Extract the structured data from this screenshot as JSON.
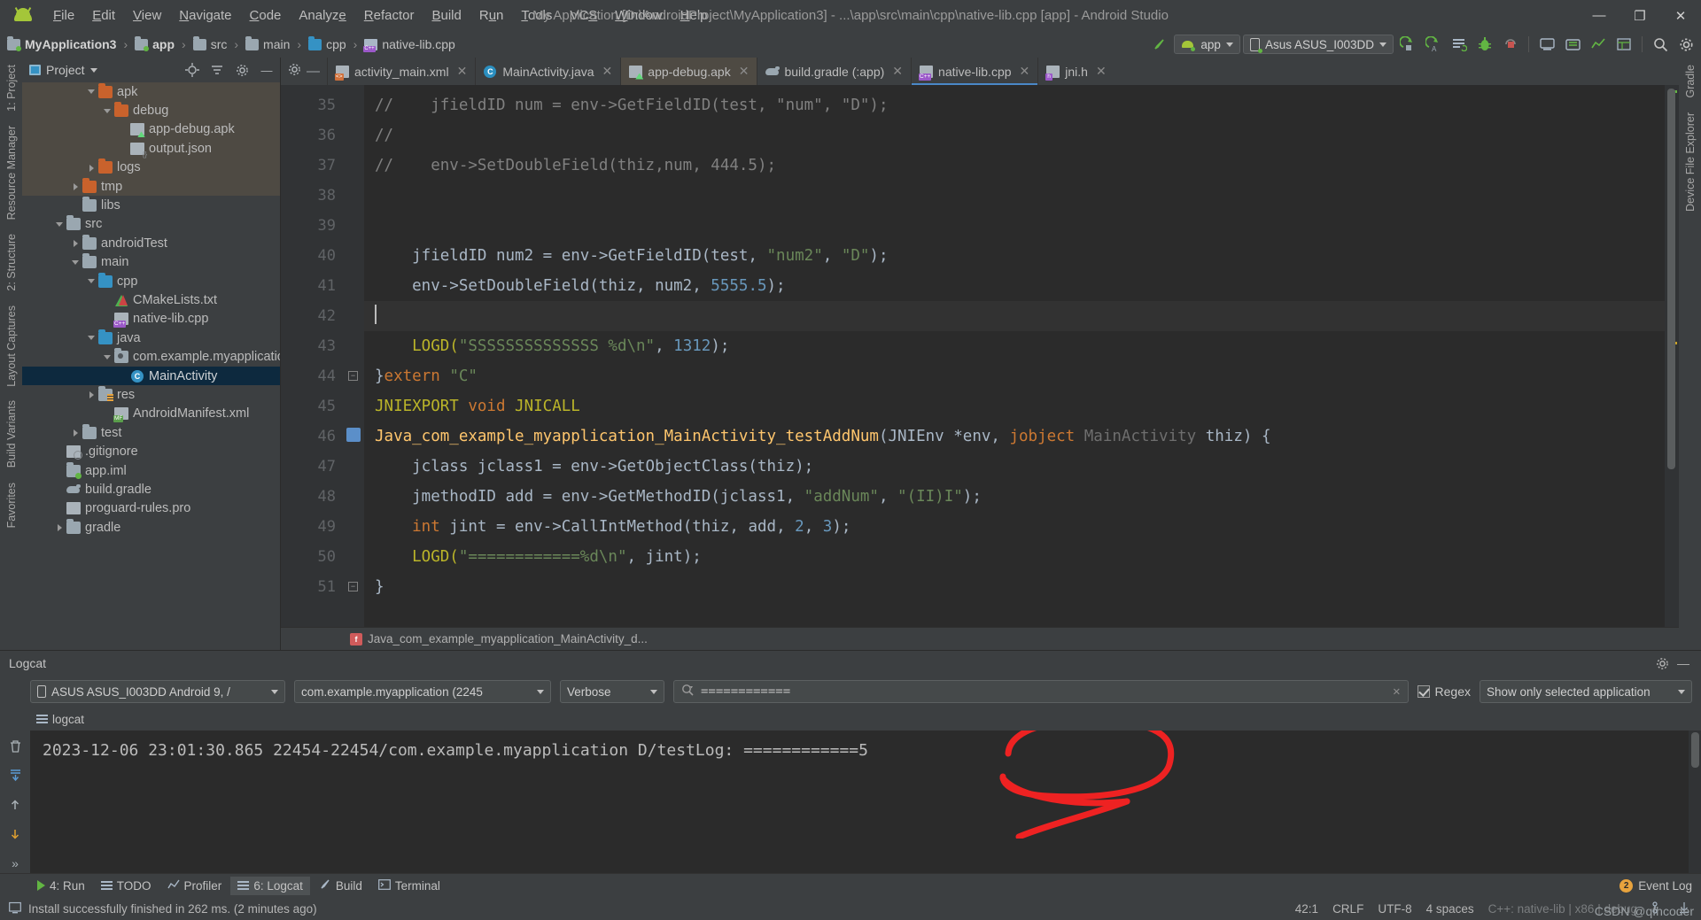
{
  "window": {
    "title": "My Application [D:\\AndroidProject\\MyApplication3] - ...\\app\\src\\main\\cpp\\native-lib.cpp [app] - Android Studio",
    "minimize": "—",
    "maximize": "❐",
    "close": "✕"
  },
  "menu": {
    "items": [
      {
        "label": "File"
      },
      {
        "label": "Edit"
      },
      {
        "label": "View"
      },
      {
        "label": "Navigate"
      },
      {
        "label": "Code"
      },
      {
        "label": "Analyze"
      },
      {
        "label": "Refactor"
      },
      {
        "label": "Build"
      },
      {
        "label": "Run"
      },
      {
        "label": "Tools"
      },
      {
        "label": "VCS"
      },
      {
        "label": "Window"
      },
      {
        "label": "Help"
      }
    ]
  },
  "breadcrumb": {
    "segments": [
      "MyApplication3",
      "app",
      "src",
      "main",
      "cpp",
      "native-lib.cpp"
    ]
  },
  "toolbar": {
    "module_selector": "app",
    "device_selector": "Asus ASUS_I003DD",
    "icons": [
      "sync-gradle-icon",
      "run-icon",
      "debug-run-icon",
      "attach-debugger-icon",
      "bug-icon",
      "stop-icon",
      "avd-manager-icon",
      "sdk-manager-icon",
      "profiler-icon",
      "layout-inspector-icon",
      "search-icon",
      "settings-icon"
    ]
  },
  "project_panel": {
    "title": "Project",
    "tree": [
      {
        "label": "apk",
        "icon": "folder-orange",
        "arrow": "down",
        "indent": 4,
        "highlight": true
      },
      {
        "label": "debug",
        "icon": "folder-orange",
        "arrow": "down",
        "indent": 5,
        "highlight": true
      },
      {
        "label": "app-debug.apk",
        "icon": "apk",
        "arrow": "none",
        "indent": 6,
        "highlight": true
      },
      {
        "label": "output.json",
        "icon": "json",
        "arrow": "none",
        "indent": 6,
        "highlight": true
      },
      {
        "label": "logs",
        "icon": "folder-orange",
        "arrow": "right",
        "indent": 4,
        "highlight": true
      },
      {
        "label": "tmp",
        "icon": "folder-orange",
        "arrow": "right",
        "indent": 3,
        "highlight": true
      },
      {
        "label": "libs",
        "icon": "folder",
        "arrow": "none",
        "indent": 3,
        "highlight": false
      },
      {
        "label": "src",
        "icon": "folder",
        "arrow": "down",
        "indent": 2,
        "highlight": false
      },
      {
        "label": "androidTest",
        "icon": "folder",
        "arrow": "right",
        "indent": 3,
        "highlight": false
      },
      {
        "label": "main",
        "icon": "folder",
        "arrow": "down",
        "indent": 3,
        "highlight": false
      },
      {
        "label": "cpp",
        "icon": "folder-blue",
        "arrow": "down",
        "indent": 4,
        "highlight": false
      },
      {
        "label": "CMakeLists.txt",
        "icon": "cmake",
        "arrow": "none",
        "indent": 5,
        "highlight": false
      },
      {
        "label": "native-lib.cpp",
        "icon": "cpp",
        "arrow": "none",
        "indent": 5,
        "highlight": false
      },
      {
        "label": "java",
        "icon": "folder-blue",
        "arrow": "down",
        "indent": 4,
        "highlight": false
      },
      {
        "label": "com.example.myapplicatio",
        "icon": "package",
        "arrow": "down",
        "indent": 5,
        "highlight": false
      },
      {
        "label": "MainActivity",
        "icon": "class",
        "arrow": "none",
        "indent": 6,
        "selected": true
      },
      {
        "label": "res",
        "icon": "folder-res",
        "arrow": "right",
        "indent": 4,
        "highlight": false
      },
      {
        "label": "AndroidManifest.xml",
        "icon": "manifest",
        "arrow": "none",
        "indent": 5,
        "highlight": false
      },
      {
        "label": "test",
        "icon": "folder",
        "arrow": "right",
        "indent": 3,
        "highlight": false
      },
      {
        "label": ".gitignore",
        "icon": "gitignore",
        "arrow": "none",
        "indent": 2,
        "highlight": false
      },
      {
        "label": "app.iml",
        "icon": "iml",
        "arrow": "none",
        "indent": 2,
        "highlight": false
      },
      {
        "label": "build.gradle",
        "icon": "gradle",
        "arrow": "none",
        "indent": 2,
        "highlight": false
      },
      {
        "label": "proguard-rules.pro",
        "icon": "properties",
        "arrow": "none",
        "indent": 2,
        "highlight": false
      },
      {
        "label": "gradle",
        "icon": "folder",
        "arrow": "right",
        "indent": 2,
        "highlight": false
      }
    ]
  },
  "left_rail": {
    "items": [
      "1: Project",
      "Resource Manager",
      "2: Structure",
      "Layout Captures",
      "Build Variants",
      "Favorites"
    ]
  },
  "right_rail": {
    "items": [
      "Gradle",
      "Device File Explorer"
    ]
  },
  "editor_tabs": [
    {
      "label": "activity_main.xml",
      "icon": "xml",
      "state": "normal"
    },
    {
      "label": "MainActivity.java",
      "icon": "java-class",
      "state": "normal"
    },
    {
      "label": "app-debug.apk",
      "icon": "apk",
      "state": "highlighted"
    },
    {
      "label": "build.gradle (:app)",
      "icon": "gradle",
      "state": "normal"
    },
    {
      "label": "native-lib.cpp",
      "icon": "cpp",
      "state": "active"
    },
    {
      "label": "jni.h",
      "icon": "header",
      "state": "normal"
    }
  ],
  "code": {
    "first_line": 35,
    "lines": [
      {
        "n": 35,
        "segs": [
          {
            "t": "//    jfieldID num = env->GetFieldID(test, \"num\", \"D\");",
            "c": "cmt"
          }
        ]
      },
      {
        "n": 36,
        "segs": [
          {
            "t": "//",
            "c": "cmt"
          }
        ]
      },
      {
        "n": 37,
        "segs": [
          {
            "t": "//    env->SetDoubleField(thiz,num, 444.5);",
            "c": "cmt"
          }
        ]
      },
      {
        "n": 38,
        "segs": []
      },
      {
        "n": 39,
        "segs": []
      },
      {
        "n": 40,
        "segs": [
          {
            "t": "    jfieldID num2 = env->GetFieldID(test, ",
            "c": "typ"
          },
          {
            "t": "\"num2\"",
            "c": "str"
          },
          {
            "t": ", ",
            "c": "typ"
          },
          {
            "t": "\"D\"",
            "c": "str"
          },
          {
            "t": ");",
            "c": "typ"
          }
        ]
      },
      {
        "n": 41,
        "segs": [
          {
            "t": "    env->SetDoubleField(thiz, num2, ",
            "c": "typ"
          },
          {
            "t": "5555.5",
            "c": "num"
          },
          {
            "t": ");",
            "c": "typ"
          }
        ]
      },
      {
        "n": 42,
        "segs": [],
        "current": true
      },
      {
        "n": 43,
        "segs": [
          {
            "t": "    LOGD(",
            "c": "mac"
          },
          {
            "t": "\"SSSSSSSSSSSSSS %d\\n\"",
            "c": "str"
          },
          {
            "t": ", ",
            "c": "typ"
          },
          {
            "t": "1312",
            "c": "num"
          },
          {
            "t": ");",
            "c": "typ"
          }
        ]
      },
      {
        "n": 44,
        "segs": [
          {
            "t": "}",
            "c": "typ"
          },
          {
            "t": "extern ",
            "c": "kw"
          },
          {
            "t": "\"C\"",
            "c": "str"
          }
        ],
        "fold": true
      },
      {
        "n": 45,
        "segs": [
          {
            "t": "JNIEXPORT ",
            "c": "mac"
          },
          {
            "t": "void ",
            "c": "kw"
          },
          {
            "t": "JNICALL",
            "c": "mac"
          }
        ]
      },
      {
        "n": 46,
        "segs": [
          {
            "t": "Java_com_example_myapplication_MainActivity_testAddNum",
            "c": "fn"
          },
          {
            "t": "(JNIEnv *",
            "c": "typ"
          },
          {
            "t": "env",
            "c": "typ"
          },
          {
            "t": ", ",
            "c": "typ"
          },
          {
            "t": "jobject ",
            "c": "kw"
          },
          {
            "t": "MainActivity ",
            "c": "ghost"
          },
          {
            "t": "thiz",
            "c": "typ"
          },
          {
            "t": ") {",
            "c": "typ"
          }
        ],
        "fold": true,
        "gutter_icon": "jni-bridge"
      },
      {
        "n": 47,
        "segs": [
          {
            "t": "    jclass jclass1 = env->GetObjectClass(thiz);",
            "c": "typ"
          }
        ]
      },
      {
        "n": 48,
        "segs": [
          {
            "t": "    jmethodID add = env->GetMethodID(jclass1, ",
            "c": "typ"
          },
          {
            "t": "\"addNum\"",
            "c": "str"
          },
          {
            "t": ", ",
            "c": "typ"
          },
          {
            "t": "\"(II)I\"",
            "c": "str"
          },
          {
            "t": ");",
            "c": "typ"
          }
        ]
      },
      {
        "n": 49,
        "segs": [
          {
            "t": "    int ",
            "c": "kw"
          },
          {
            "t": "jint",
            "c": "typ"
          },
          {
            "t": " = env->CallIntMethod(thiz, add, ",
            "c": "typ"
          },
          {
            "t": "2",
            "c": "num"
          },
          {
            "t": ", ",
            "c": "typ"
          },
          {
            "t": "3",
            "c": "num"
          },
          {
            "t": ");",
            "c": "typ"
          }
        ]
      },
      {
        "n": 50,
        "segs": [
          {
            "t": "    LOGD(",
            "c": "mac"
          },
          {
            "t": "\"============%d\\n\"",
            "c": "str"
          },
          {
            "t": ", jint);",
            "c": "typ"
          }
        ]
      },
      {
        "n": 51,
        "segs": [
          {
            "t": "}",
            "c": "typ"
          }
        ],
        "fold": true
      }
    ]
  },
  "editor_breadcrumb": {
    "label": "Java_com_example_myapplication_MainActivity_d..."
  },
  "logcat": {
    "title": "Logcat",
    "device_selector": "ASUS ASUS_I003DD Android 9, /",
    "process_selector": "com.example.myapplication (2245",
    "level_selector": "Verbose",
    "search_value": "============",
    "search_clear": "✕",
    "regex_label": "Regex",
    "filter_selector": "Show only selected application",
    "tab_label": "logcat",
    "output": "2023-12-06 23:01:30.865 22454-22454/com.example.myapplication D/testLog: ============5",
    "rail_icons": [
      "clear-logcat-icon",
      "scroll-to-end-icon",
      "up-arrow-icon",
      "down-arrow-icon",
      "more-icon"
    ],
    "annotation_color": "#ee2222"
  },
  "bottom_bar": {
    "items": [
      {
        "label": "4: Run",
        "icon": "run-icon",
        "active": false
      },
      {
        "label": "TODO",
        "icon": "todo-icon",
        "active": false
      },
      {
        "label": "Profiler",
        "icon": "profiler-icon",
        "active": false
      },
      {
        "label": "6: Logcat",
        "icon": "logcat-icon",
        "active": true
      },
      {
        "label": "Build",
        "icon": "build-icon",
        "active": false
      },
      {
        "label": "Terminal",
        "icon": "terminal-icon",
        "active": false
      }
    ],
    "event_log": "Event Log",
    "event_count": "2"
  },
  "status_bar": {
    "message": "Install successfully finished in 262 ms. (2 minutes ago)",
    "caret_position": "42:1",
    "line_separator": "CRLF",
    "encoding": "UTF-8",
    "indent": "4 spaces",
    "context": "C++: native-lib | x86 | debug",
    "watermark": "CSDN @qfhcoder"
  },
  "colors": {
    "accent_blue": "#4a88c7",
    "selection": "#0d293e",
    "highlight_row": "#4e4a43",
    "editor_bg": "#2b2b2b",
    "panel_bg": "#3c3f41",
    "annotation_red": "#ee2222"
  }
}
